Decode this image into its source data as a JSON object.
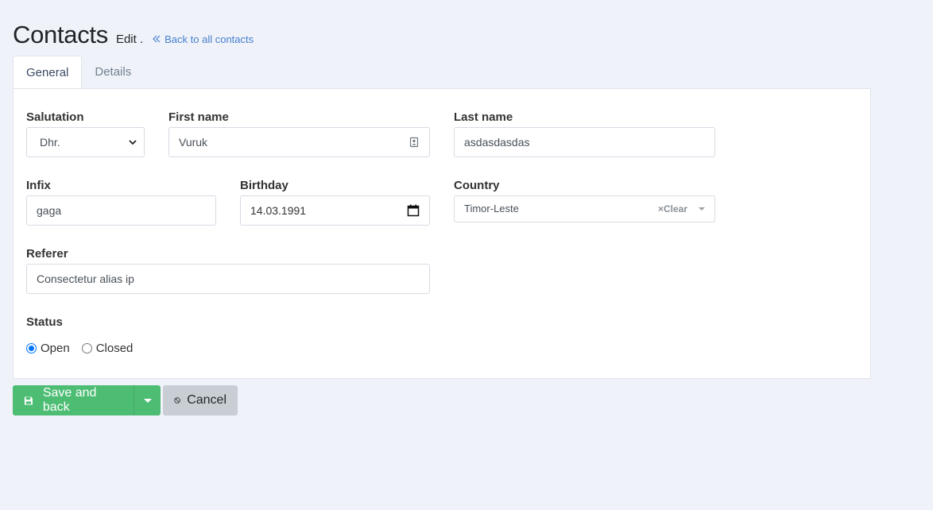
{
  "header": {
    "title": "Contacts",
    "subtitle": "Edit .",
    "back_link": "Back to all contacts"
  },
  "tabs": [
    {
      "label": "General",
      "active": true
    },
    {
      "label": "Details",
      "active": false
    }
  ],
  "form": {
    "salutation": {
      "label": "Salutation",
      "value": "Dhr."
    },
    "first_name": {
      "label": "First name",
      "value": "Vuruk"
    },
    "last_name": {
      "label": "Last name",
      "value": "asdasdasdas"
    },
    "infix": {
      "label": "Infix",
      "value": "gaga"
    },
    "birthday": {
      "label": "Birthday",
      "value": "14.03.1991"
    },
    "country": {
      "label": "Country",
      "value": "Timor-Leste",
      "clear_label": "×Clear"
    },
    "referer": {
      "label": "Referer",
      "value": "Consectetur alias ip"
    },
    "status": {
      "label": "Status",
      "options": [
        {
          "label": "Open",
          "checked": true
        },
        {
          "label": "Closed",
          "checked": false
        }
      ]
    }
  },
  "actions": {
    "save_label": "Save and back",
    "cancel_label": "Cancel"
  },
  "colors": {
    "background": "#eff2f9",
    "link": "#467fcf",
    "save": "#4dbd74",
    "cancel": "#c8ced3"
  },
  "icons": {
    "back": "double-chevron-left-icon",
    "contact_card": "contact-card-icon",
    "calendar": "calendar-icon",
    "select_arrow": "chevron-down-icon",
    "save": "floppy-disk-icon",
    "cancel": "ban-icon"
  }
}
